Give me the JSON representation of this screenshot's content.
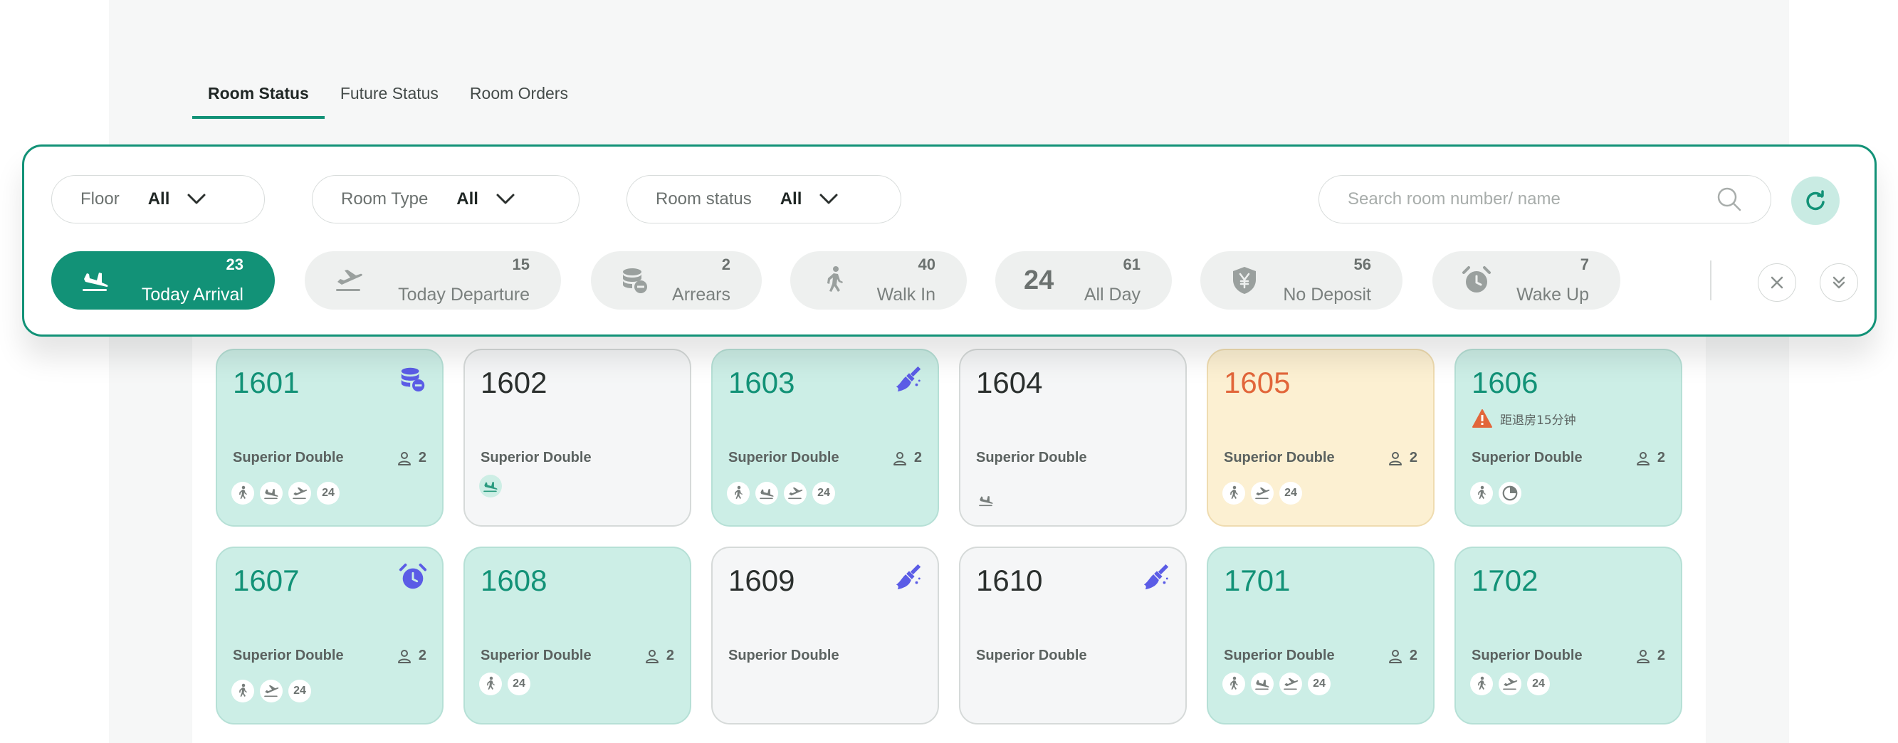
{
  "tabs": [
    {
      "label": "Room Status",
      "active": true
    },
    {
      "label": "Future Status",
      "active": false
    },
    {
      "label": "Room Orders",
      "active": false
    }
  ],
  "filters": {
    "floor": {
      "label": "Floor",
      "value": "All"
    },
    "room_type": {
      "label": "Room Type",
      "value": "All"
    },
    "room_status": {
      "label": "Room status",
      "value": "All"
    },
    "search_placeholder": "Search room number/ name"
  },
  "chips": [
    {
      "label": "Today Arrival",
      "count": "23",
      "icon": "arrival-icon",
      "active": true
    },
    {
      "label": "Today Departure",
      "count": "15",
      "icon": "departure-icon",
      "active": false
    },
    {
      "label": "Arrears",
      "count": "2",
      "icon": "coins-icon",
      "active": false
    },
    {
      "label": "Walk In",
      "count": "40",
      "icon": "walk-icon",
      "active": false
    },
    {
      "label": "All Day",
      "count": "61",
      "icon": "24",
      "active": false
    },
    {
      "label": "No Deposit",
      "count": "56",
      "icon": "shield-yen-icon",
      "active": false
    },
    {
      "label": "Wake Up",
      "count": "7",
      "icon": "alarm-icon",
      "active": false
    }
  ],
  "rooms": [
    {
      "number": "1601",
      "type": "Superior Double",
      "guests": "2",
      "color": "teal",
      "corner_icon": "coins-icon",
      "tags": [
        "walk",
        "arrival",
        "departure",
        "24"
      ]
    },
    {
      "number": "1602",
      "type": "Superior Double",
      "guests": "",
      "color": "gray",
      "corner_icon": "",
      "tags": [
        "arrival-green"
      ]
    },
    {
      "number": "1603",
      "type": "Superior Double",
      "guests": "2",
      "color": "teal",
      "corner_icon": "broom-icon",
      "tags": [
        "walk",
        "arrival",
        "departure",
        "24"
      ]
    },
    {
      "number": "1604",
      "type": "Superior Double",
      "guests": "",
      "color": "gray",
      "corner_icon": "",
      "tags": [
        "arrival-plain"
      ]
    },
    {
      "number": "1605",
      "type": "Superior Double",
      "guests": "2",
      "color": "yellow",
      "corner_icon": "",
      "tags": [
        "walk",
        "departure",
        "24"
      ]
    },
    {
      "number": "1606",
      "type": "Superior Double",
      "guests": "2",
      "color": "teal",
      "corner_icon": "",
      "warning": "距退房15分钟",
      "tags": [
        "walk",
        "pie"
      ]
    },
    {
      "number": "1607",
      "type": "Superior Double",
      "guests": "2",
      "color": "teal",
      "corner_icon": "alarm-icon",
      "tags": [
        "walk",
        "departure",
        "24"
      ]
    },
    {
      "number": "1608",
      "type": "Superior Double",
      "guests": "2",
      "color": "teal",
      "corner_icon": "",
      "tags": [
        "walk",
        "24"
      ]
    },
    {
      "number": "1609",
      "type": "Superior Double",
      "guests": "",
      "color": "gray",
      "corner_icon": "broom-icon",
      "tags": []
    },
    {
      "number": "1610",
      "type": "Superior Double",
      "guests": "",
      "color": "gray",
      "corner_icon": "broom-icon",
      "tags": []
    },
    {
      "number": "1701",
      "type": "Superior Double",
      "guests": "2",
      "color": "teal",
      "corner_icon": "",
      "tags": [
        "walk",
        "arrival",
        "departure",
        "24"
      ]
    },
    {
      "number": "1702",
      "type": "Superior Double",
      "guests": "2",
      "color": "teal",
      "corner_icon": "",
      "tags": [
        "walk",
        "departure",
        "24"
      ]
    }
  ],
  "colors": {
    "accent": "#129277",
    "icon_purple": "#5b5ce6",
    "warning": "#e2663a"
  }
}
